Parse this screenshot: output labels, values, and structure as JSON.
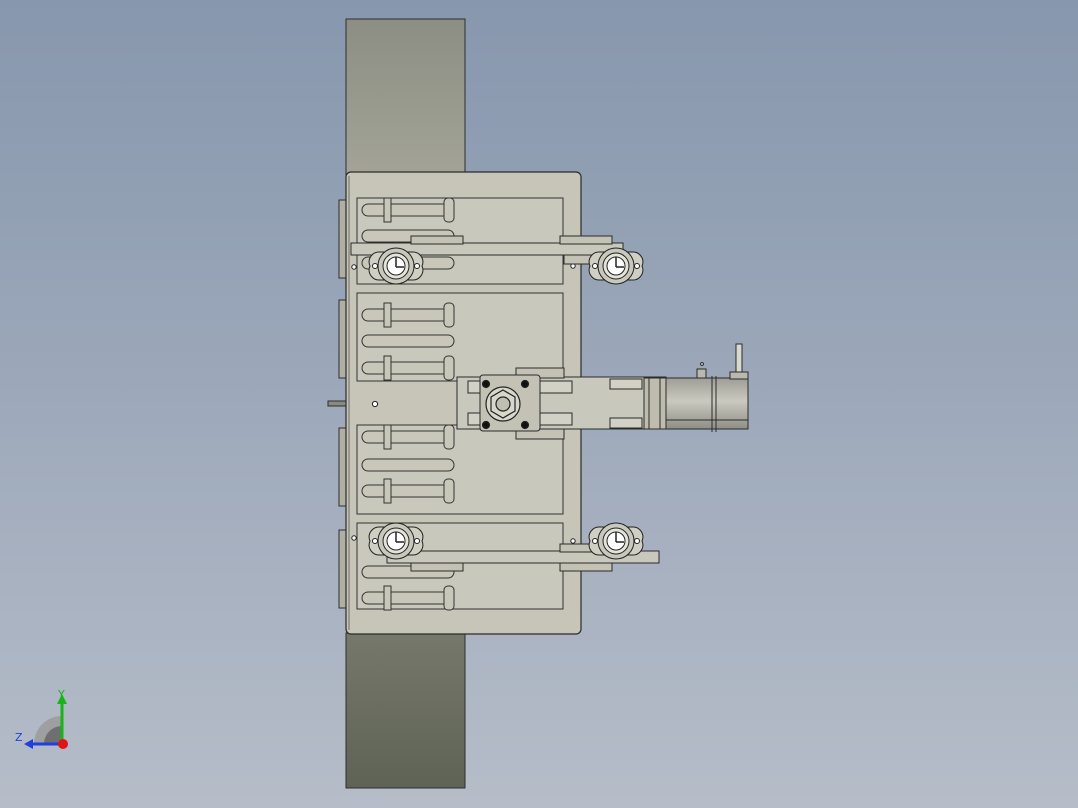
{
  "viewport": {
    "background_top": "#8797ad",
    "background_bottom": "#b6bdc9"
  },
  "model": {
    "name": "",
    "view": "front",
    "colors": {
      "plate": "#c4c3b6",
      "belt_top": "#9a9b90",
      "belt_bottom": "#666a5c",
      "outline": "#2b2b2b",
      "motor": "#b5b5ab"
    }
  },
  "triad": {
    "labels": {
      "y": "Y",
      "z": "Z"
    },
    "colors": {
      "y": "#18b418",
      "z": "#1f3fe0",
      "x": "#e01414",
      "plane": "#9a9a9a"
    }
  }
}
